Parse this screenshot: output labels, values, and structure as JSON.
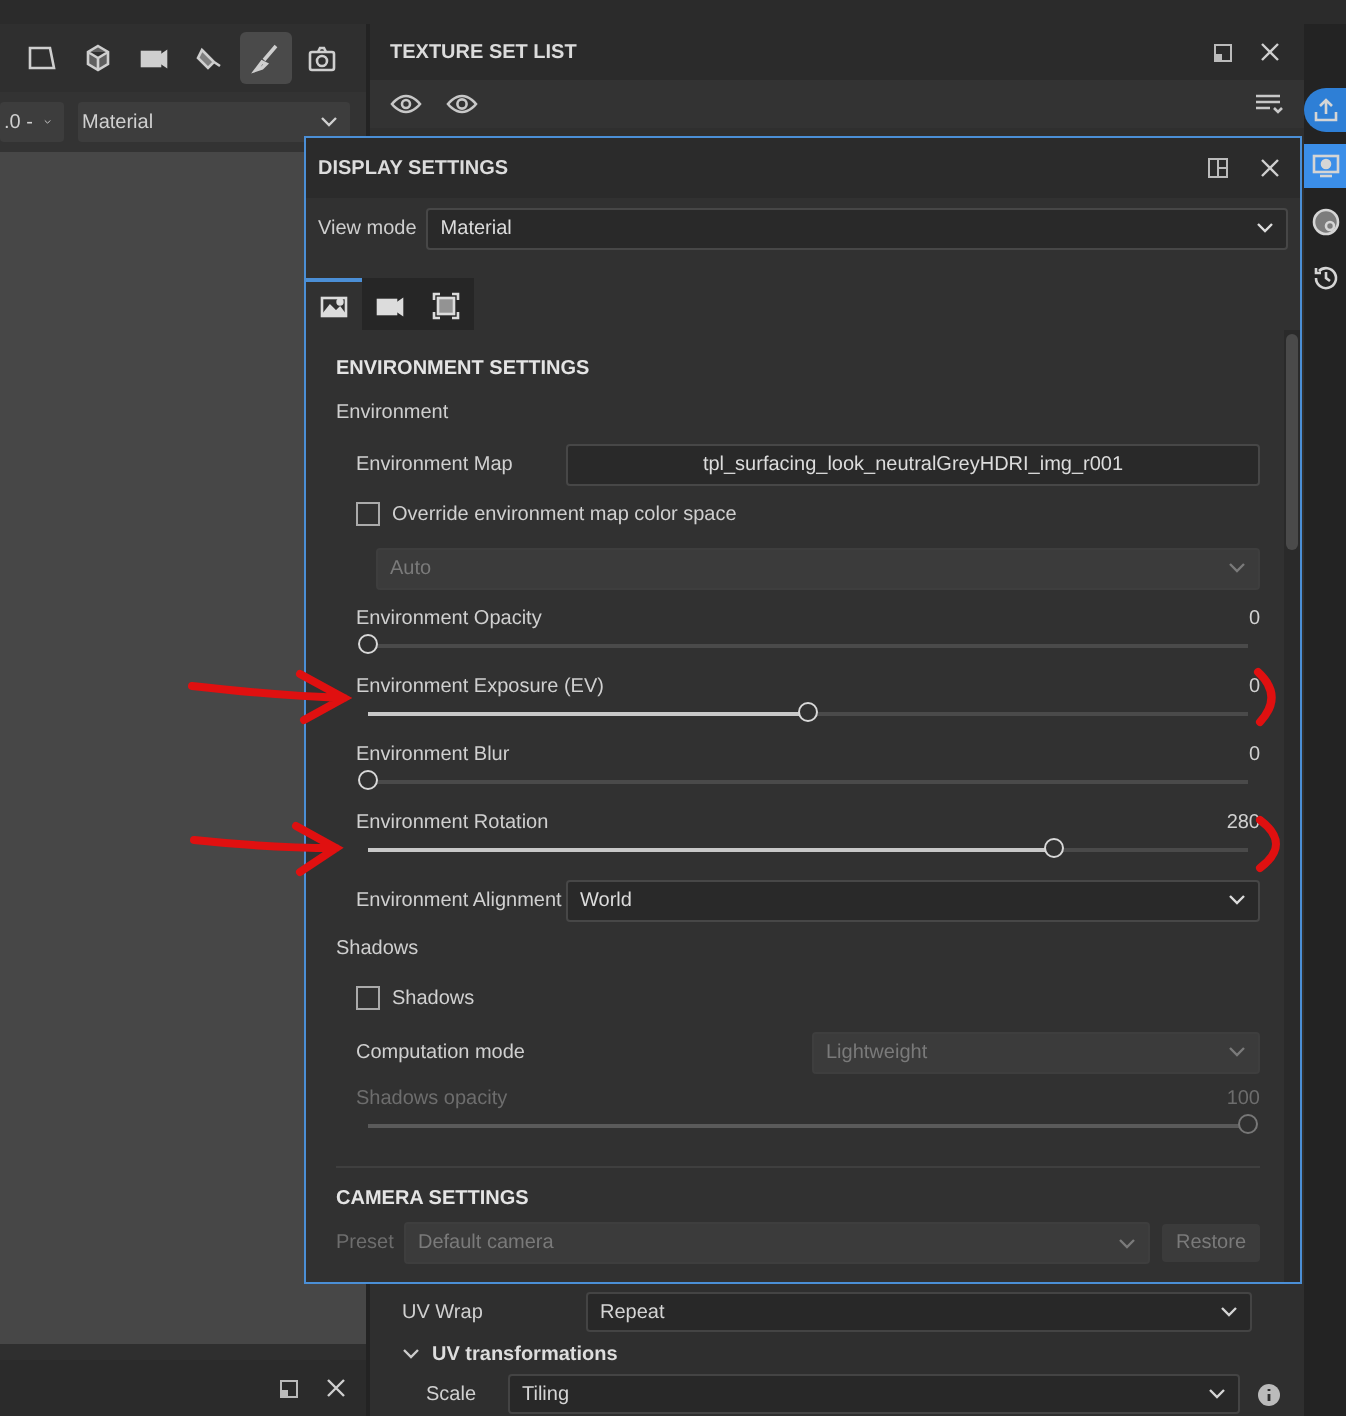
{
  "toolbar": {
    "tools": [
      {
        "kind": "frame",
        "selected": false
      },
      {
        "kind": "cube",
        "selected": false
      },
      {
        "kind": "camera",
        "selected": false
      },
      {
        "kind": "fill",
        "selected": false
      },
      {
        "kind": "brush",
        "selected": true
      },
      {
        "kind": "snapshot",
        "selected": false
      }
    ]
  },
  "viewport_bar": {
    "dropdown_1": ".0 -",
    "dropdown_2": "Material"
  },
  "texture_set_list": {
    "title": "TEXTURE SET LIST"
  },
  "properties": {
    "uv_wrap": {
      "label": "UV Wrap",
      "value": "Repeat"
    },
    "uv_transformations": {
      "label": "UV transformations",
      "expanded": true
    },
    "scale": {
      "label": "Scale",
      "value": "Tiling"
    }
  },
  "side_dock": {
    "items": [
      {
        "kind": "share",
        "selected": true
      },
      {
        "kind": "display",
        "selected": true
      },
      {
        "kind": "globe",
        "selected": false
      },
      {
        "kind": "history",
        "selected": false
      }
    ]
  },
  "display_settings": {
    "title": "DISPLAY SETTINGS",
    "view_mode": {
      "label": "View mode",
      "value": "Material"
    },
    "tabs": [
      {
        "kind": "environment",
        "selected": true
      },
      {
        "kind": "camera",
        "selected": false
      },
      {
        "kind": "frame",
        "selected": false
      }
    ],
    "environment_settings": {
      "heading": "ENVIRONMENT SETTINGS",
      "environment_group": "Environment",
      "environment_map": {
        "label": "Environment Map",
        "value": "tpl_surfacing_look_neutralGreyHDRI_img_r001"
      },
      "override": {
        "label": "Override environment map color space",
        "checked": false
      },
      "color_space": {
        "value": "Auto",
        "disabled": true
      },
      "sliders": [
        {
          "label": "Environment Opacity",
          "reading": "0",
          "level": 0
        },
        {
          "label": "Environment Exposure (EV)",
          "reading": "0",
          "level": 0.5
        },
        {
          "label": "Environment Blur",
          "reading": "0",
          "level": 0
        },
        {
          "label": "Environment Rotation",
          "reading": "280",
          "level": 0.78
        }
      ],
      "alignment": {
        "label": "Environment Alignment",
        "value": "World"
      },
      "shadows_group": "Shadows",
      "shadows": {
        "label": "Shadows",
        "checked": false
      },
      "computation_mode": {
        "label": "Computation mode",
        "value": "Lightweight",
        "disabled": true
      },
      "shadows_opacity": {
        "label": "Shadows opacity",
        "reading": "100",
        "level": 1,
        "disabled": true
      }
    },
    "camera_settings": {
      "heading": "CAMERA SETTINGS",
      "preset": {
        "label": "Preset",
        "value": "Default camera",
        "disabled": true
      },
      "restore": "Restore"
    }
  }
}
